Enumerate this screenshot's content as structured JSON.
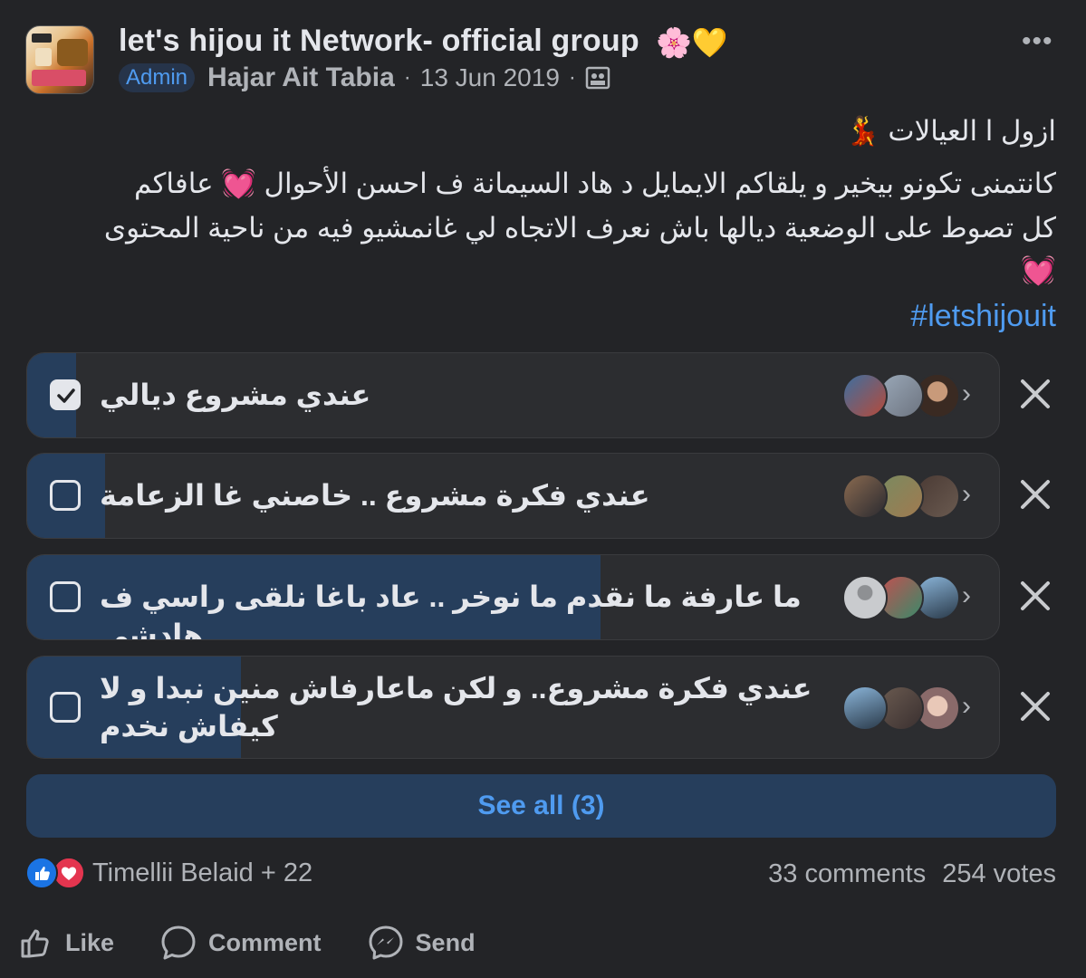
{
  "post": {
    "group_name": "let's hijou it Network- official group",
    "title_emoji": "🌸💛",
    "badge": "Admin",
    "author": "Hajar Ait Tabia",
    "separator": "·",
    "date": "13 Jun 2019",
    "more_glyph": "•••",
    "text_line1": "ازول ا العيالات 💃",
    "text_line2": "كانتمنى تكونو بيخير و يلقاكم الايمايل د هاد السيمانة ف احسن الأحوال 💓 عافاكم",
    "text_line3": "كل تصوط على الوضعية ديالها باش نعرف الاتجاه لي غانمشيو فيه من ناحية المحتوى",
    "text_line4": "💓",
    "hashtag": "#letshijouit"
  },
  "poll": {
    "options": [
      {
        "label": "عندي مشروع ديالي",
        "checked": true,
        "fill_fraction": 0.05
      },
      {
        "label": "عندي فكرة مشروع .. خاصني غا الزعامة",
        "checked": false,
        "fill_fraction": 0.08
      },
      {
        "label": "ما عارفة ما نقدم ما نوخر .. عاد باغا نلقى راسي ف هادشي",
        "checked": false,
        "fill_fraction": 0.59
      },
      {
        "label": "عندي فكرة مشروع.. و لكن ماعارفاش منين نبدا و لا كيفاش نخدم",
        "checked": false,
        "fill_fraction": 0.22
      }
    ],
    "chevron": "›",
    "see_all": "See all (3)"
  },
  "footer": {
    "reactors": "Timellii Belaid + 22",
    "comments": "33 comments",
    "votes": "254 votes",
    "like": "Like",
    "comment": "Comment",
    "send": "Send"
  },
  "colors": {
    "background": "#232427",
    "accent": "#4f9bf0",
    "poll_fill": "#263e5c",
    "like_blue": "#1b74e4",
    "love_red": "#e4354f"
  }
}
